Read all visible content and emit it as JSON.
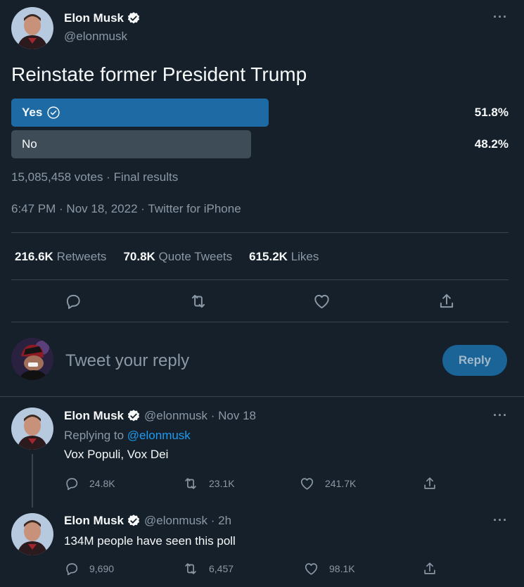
{
  "tweet": {
    "author_name": "Elon Musk",
    "author_handle": "@elonmusk",
    "text": "Reinstate former President Trump",
    "poll": {
      "options": [
        {
          "label": "Yes",
          "percent": "51.8%",
          "share": 0.518,
          "winner": true
        },
        {
          "label": "No",
          "percent": "48.2%",
          "share": 0.482,
          "winner": false
        }
      ],
      "votes": "15,085,458 votes",
      "status": "Final results"
    },
    "time": "6:47 PM",
    "date": "Nov 18, 2022",
    "source": "Twitter for iPhone",
    "stats": {
      "retweets_count": "216.6K",
      "retweets_label": "Retweets",
      "quotes_count": "70.8K",
      "quotes_label": "Quote Tweets",
      "likes_count": "615.2K",
      "likes_label": "Likes"
    }
  },
  "composer": {
    "placeholder": "Tweet your reply",
    "button_label": "Reply"
  },
  "replies": [
    {
      "author_name": "Elon Musk",
      "author_handle": "@elonmusk",
      "time": "Nov 18",
      "replying_prefix": "Replying to",
      "replying_to": "@elonmusk",
      "text": "Vox Populi, Vox Dei",
      "replies": "24.8K",
      "retweets": "23.1K",
      "likes": "241.7K"
    },
    {
      "author_name": "Elon Musk",
      "author_handle": "@elonmusk",
      "time": "2h",
      "text": "134M people have seen this poll",
      "replies": "9,690",
      "retweets": "6,457",
      "likes": "98.1K"
    }
  ],
  "colors": {
    "background": "#15202b",
    "accent": "#1d9bf0",
    "poll_winner": "#1d6aa5",
    "poll_other": "#3e4c58"
  },
  "icons": [
    "verified-badge-icon",
    "more-icon",
    "reply-icon",
    "retweet-icon",
    "like-icon",
    "share-icon",
    "check-circle-icon"
  ]
}
